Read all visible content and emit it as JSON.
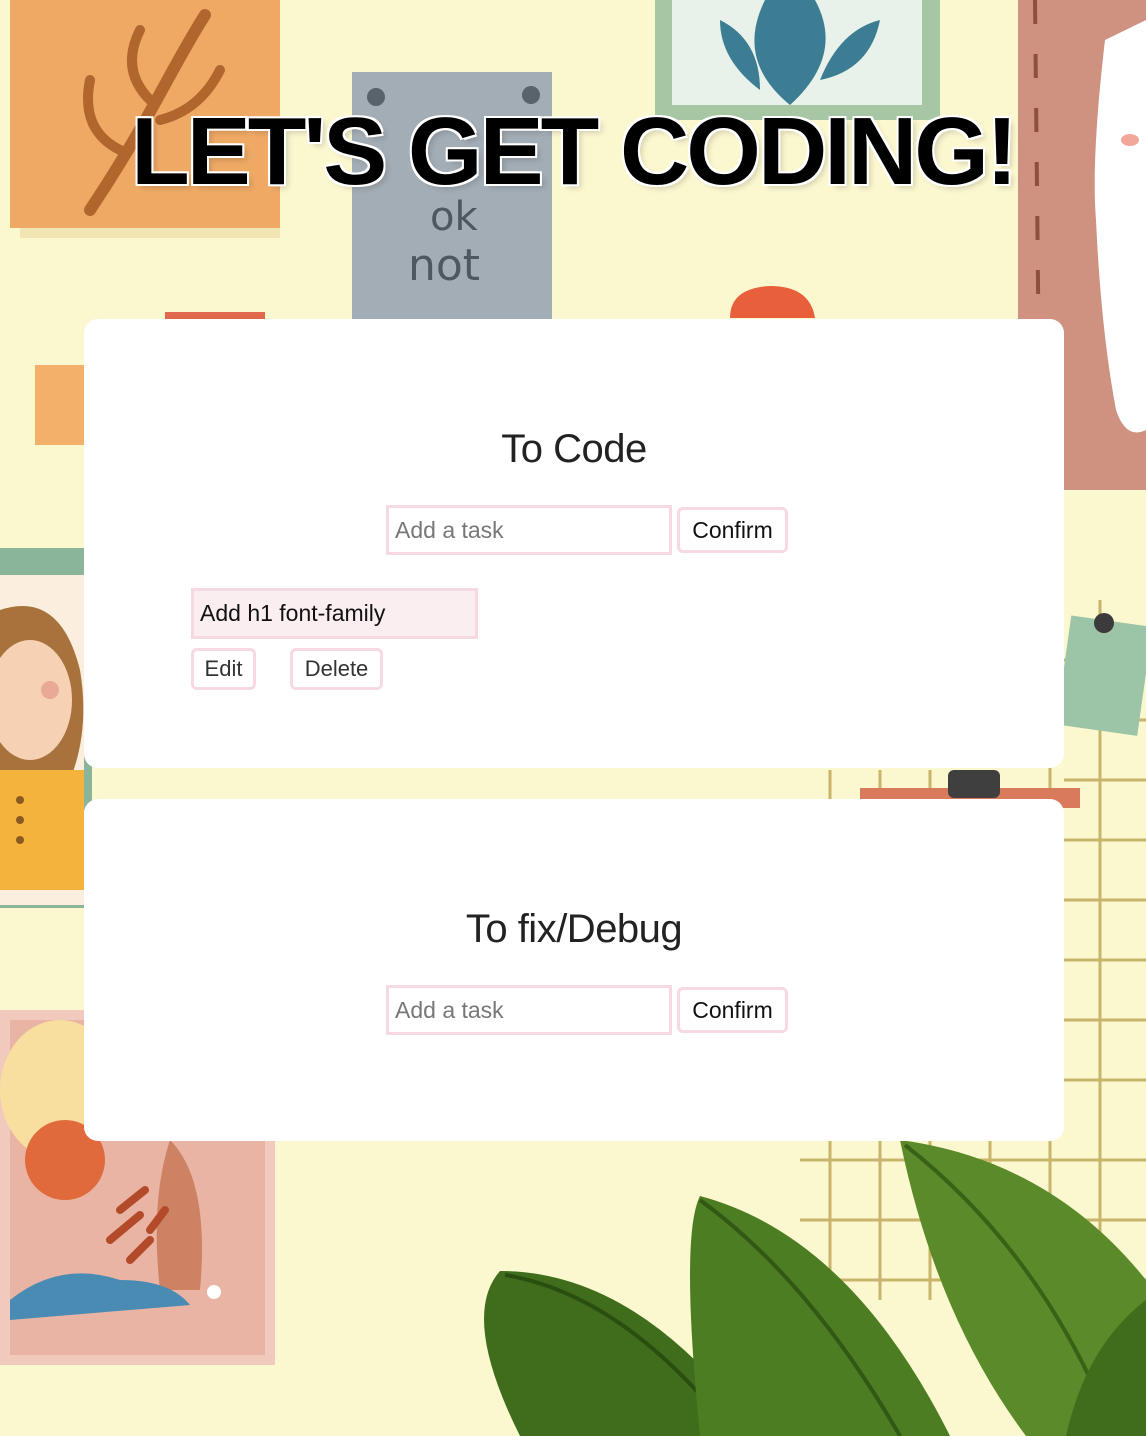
{
  "page": {
    "title": "LET'S GET CODING!"
  },
  "background": {
    "description_colors": {
      "wall": "#fbf7cf",
      "orange_card": "#eea965",
      "leaf_green": "#3f6f1f"
    }
  },
  "lists": [
    {
      "title": "To Code",
      "input": {
        "placeholder": "Add a task",
        "value": ""
      },
      "confirm_label": "Confirm",
      "tasks": [
        {
          "text": "Add h1 font-family",
          "edit_label": "Edit",
          "delete_label": "Delete"
        }
      ]
    },
    {
      "title": "To fix/Debug",
      "input": {
        "placeholder": "Add a task",
        "value": ""
      },
      "confirm_label": "Confirm",
      "tasks": []
    }
  ],
  "colors": {
    "accent_border": "#f6d9e1",
    "task_bg": "#fbeef1",
    "card_bg": "#ffffff"
  }
}
